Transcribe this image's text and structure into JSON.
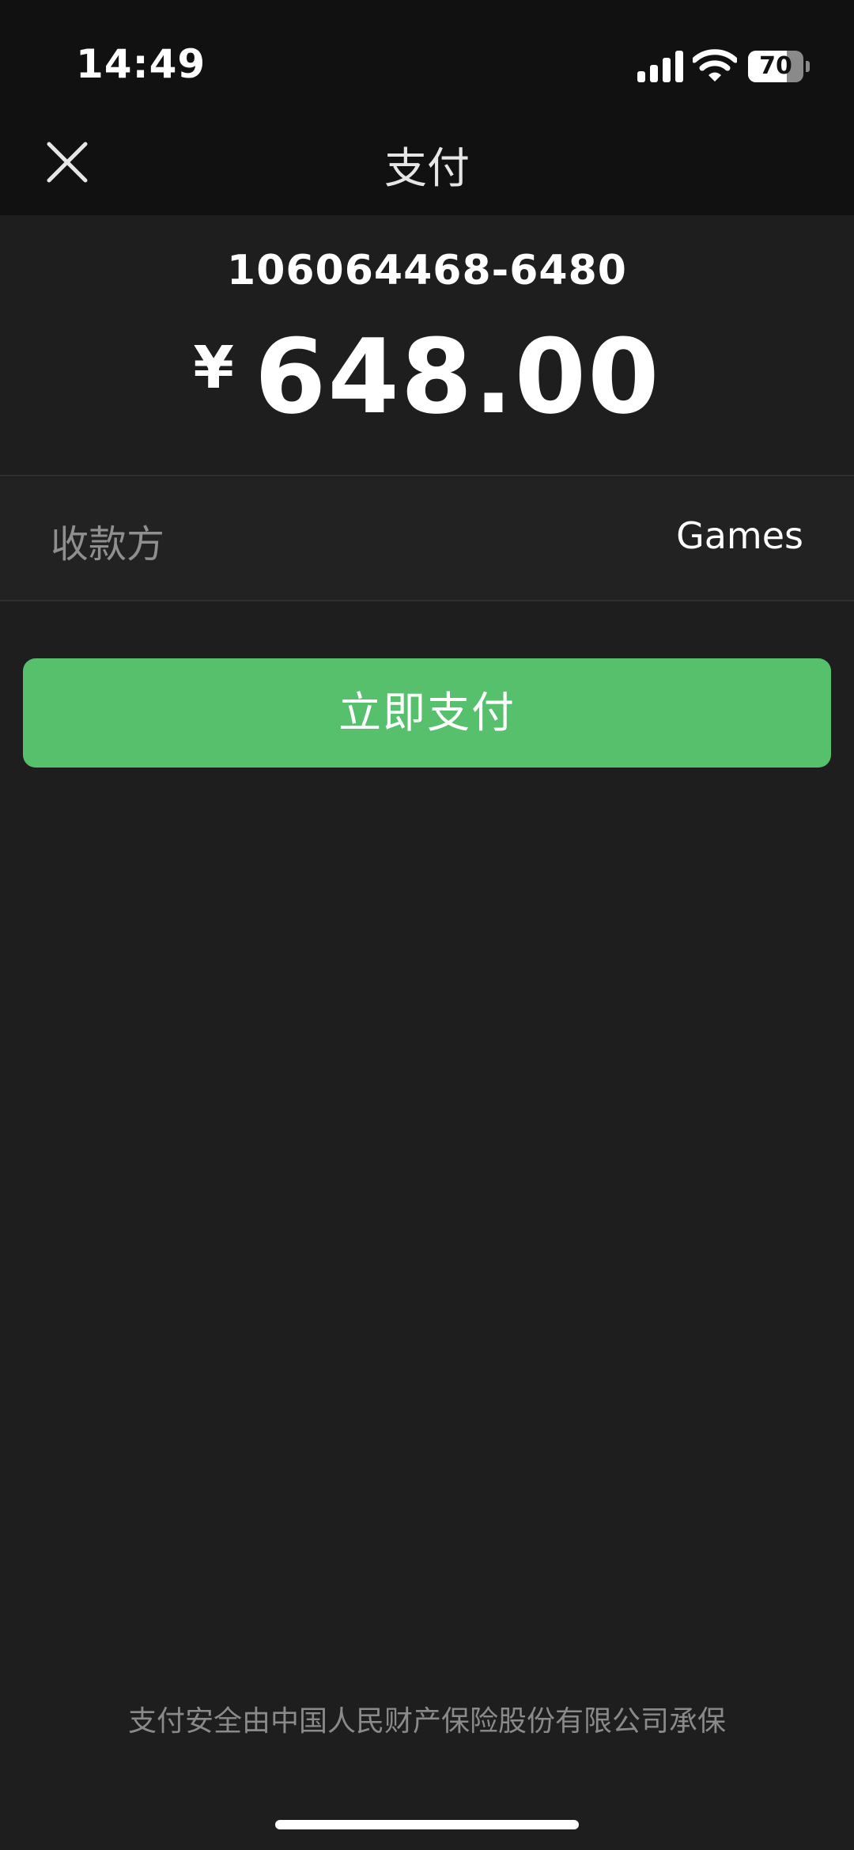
{
  "status_bar": {
    "time": "14:49",
    "battery_percent": "70",
    "battery_level": 0.7,
    "icons": [
      "signal-icon",
      "wifi-icon",
      "battery-icon"
    ]
  },
  "nav": {
    "title": "支付",
    "close_icon": "close-icon"
  },
  "order": {
    "id": "106064468-6480",
    "currency_symbol": "¥",
    "amount": "648.00"
  },
  "payee": {
    "label": "收款方",
    "value": "Games"
  },
  "actions": {
    "pay_label": "立即支付"
  },
  "footer": {
    "note": "支付安全由中国人民财产保险股份有限公司承保"
  },
  "colors": {
    "background": "#1e1e1e",
    "header_background": "#111111",
    "accent_green": "#57c06c",
    "secondary_text": "#8f8f8f"
  }
}
